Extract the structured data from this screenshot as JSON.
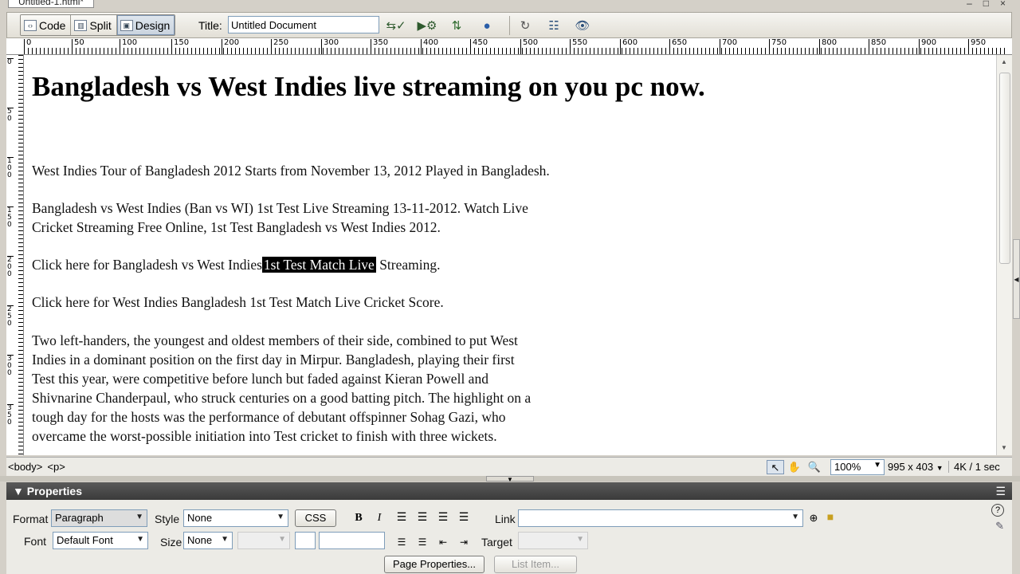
{
  "document_tab": "Untitled-1.html*",
  "toolbar": {
    "views": [
      {
        "label": "Code",
        "icon": "code-view-icon",
        "active": false
      },
      {
        "label": "Split",
        "icon": "split-view-icon",
        "active": false
      },
      {
        "label": "Design",
        "icon": "design-view-icon",
        "active": true
      }
    ],
    "title_label": "Title:",
    "title_value": "Untitled Document"
  },
  "rulers": {
    "h_labels": [
      "0",
      "50",
      "100",
      "150",
      "200",
      "250",
      "300",
      "350",
      "400",
      "450",
      "500",
      "550",
      "600",
      "650",
      "700",
      "750",
      "800",
      "850",
      "900",
      "950"
    ],
    "v_labels": [
      "0",
      "5 0",
      "1 0 0",
      "1 5 0",
      "2 0 0",
      "2 5 0",
      "3 0 0",
      "3 5 0"
    ]
  },
  "page": {
    "heading": "Bangladesh vs West Indies live streaming on you pc now.",
    "p1": "West Indies Tour of Bangladesh 2012 Starts from November 13, 2012 Played in Bangladesh.",
    "p2_line1": "Bangladesh vs West Indies (Ban vs WI) 1st Test Live Streaming 13-11-2012. Watch Live",
    "p2_line2": "Cricket Streaming Free Online, 1st Test Bangladesh vs West Indies 2012.",
    "p3_before": "Click here for Bangladesh vs West Indies",
    "p3_selected": "1st Test Match Live",
    "p3_after": " Streaming.",
    "p4": "Click here for West Indies Bangladesh 1st Test Match Live Cricket Score.",
    "p5_lines": [
      "Two left-handers, the youngest and oldest members of their side, combined to put West",
      "Indies in a dominant position on the first day in Mirpur. Bangladesh, playing their first",
      "Test this year, were competitive before lunch but faded against Kieran Powell and",
      "Shivnarine Chanderpaul, who struck centuries on a good batting pitch. The highlight on a",
      "tough day for the hosts was the performance of debutant offspinner Sohag Gazi, who",
      "overcame the worst-possible initiation into Test cricket to finish with three wickets."
    ]
  },
  "status": {
    "tags": [
      "<body>",
      "<p>"
    ],
    "zoom": "100%",
    "window_size": "995 x 403",
    "download": "4K / 1 sec"
  },
  "properties": {
    "title": "Properties",
    "format_label": "Format",
    "format_value": "Paragraph",
    "style_label": "Style",
    "style_value": "None",
    "css_button": "CSS",
    "bold": "B",
    "italic": "I",
    "link_label": "Link",
    "font_label": "Font",
    "font_value": "Default Font",
    "size_label": "Size",
    "size_value": "None",
    "target_label": "Target",
    "page_properties_button": "Page Properties...",
    "list_item_button": "List Item..."
  }
}
